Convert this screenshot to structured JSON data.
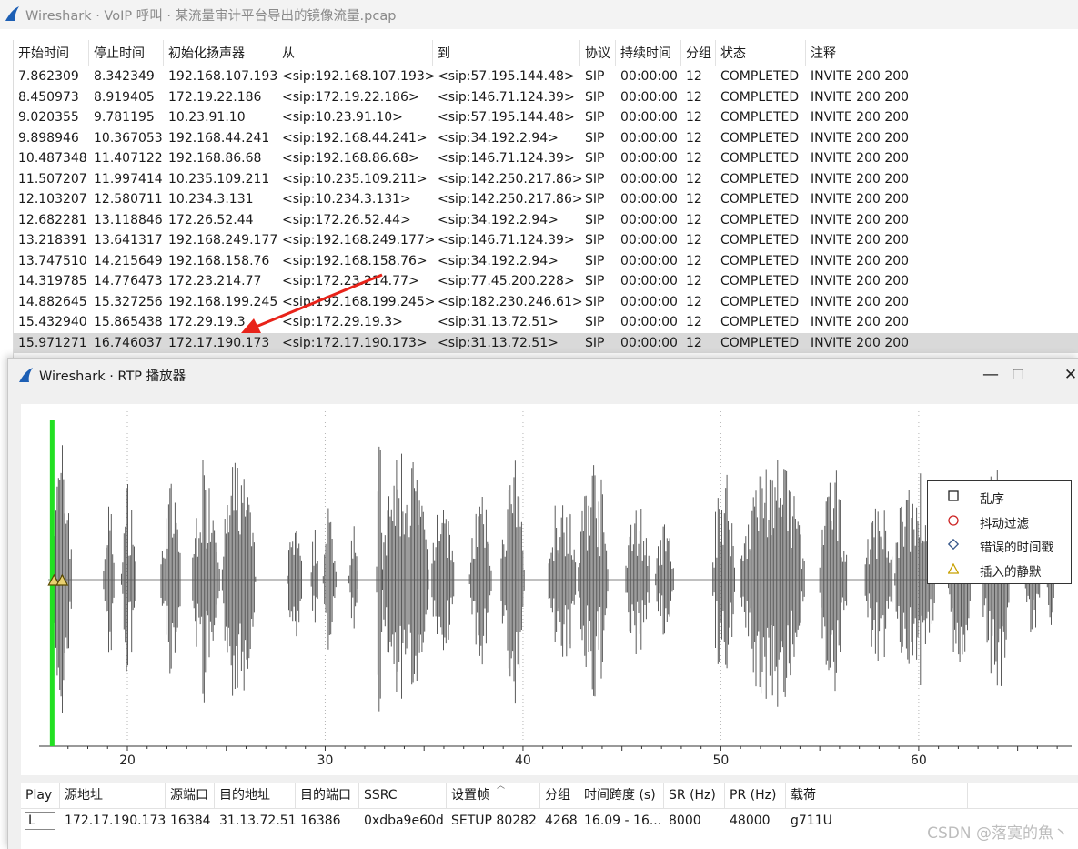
{
  "bg_window": {
    "title": "Wireshark · VoIP 呼叫 · 某流量审计平台导出的镜像流量.pcap",
    "columns": [
      "开始时间",
      "停止时间",
      "初始化扬声器",
      "从",
      "到",
      "协议",
      "持续时间",
      "分组",
      "状态",
      "注释"
    ],
    "rows": [
      [
        "7.862309",
        "8.342349",
        "192.168.107.193",
        "<sip:192.168.107.193>",
        "<sip:57.195.144.48>",
        "SIP",
        "00:00:00",
        "12",
        "COMPLETED",
        "INVITE 200 200"
      ],
      [
        "8.450973",
        "8.919405",
        "172.19.22.186",
        "<sip:172.19.22.186>",
        "<sip:146.71.124.39>",
        "SIP",
        "00:00:00",
        "12",
        "COMPLETED",
        "INVITE 200 200"
      ],
      [
        "9.020355",
        "9.781195",
        "10.23.91.10",
        "<sip:10.23.91.10>",
        "<sip:57.195.144.48>",
        "SIP",
        "00:00:00",
        "12",
        "COMPLETED",
        "INVITE 200 200"
      ],
      [
        "9.898946",
        "10.367053",
        "192.168.44.241",
        "<sip:192.168.44.241>",
        "<sip:34.192.2.94>",
        "SIP",
        "00:00:00",
        "12",
        "COMPLETED",
        "INVITE 200 200"
      ],
      [
        "10.487348",
        "11.407122",
        "192.168.86.68",
        "<sip:192.168.86.68>",
        "<sip:146.71.124.39>",
        "SIP",
        "00:00:00",
        "12",
        "COMPLETED",
        "INVITE 200 200"
      ],
      [
        "11.507207",
        "11.997414",
        "10.235.109.211",
        "<sip:10.235.109.211>",
        "<sip:142.250.217.86>",
        "SIP",
        "00:00:00",
        "12",
        "COMPLETED",
        "INVITE 200 200"
      ],
      [
        "12.103207",
        "12.580711",
        "10.234.3.131",
        "<sip:10.234.3.131>",
        "<sip:142.250.217.86>",
        "SIP",
        "00:00:00",
        "12",
        "COMPLETED",
        "INVITE 200 200"
      ],
      [
        "12.682281",
        "13.118846",
        "172.26.52.44",
        "<sip:172.26.52.44>",
        "<sip:34.192.2.94>",
        "SIP",
        "00:00:00",
        "12",
        "COMPLETED",
        "INVITE 200 200"
      ],
      [
        "13.218391",
        "13.641317",
        "192.168.249.177",
        "<sip:192.168.249.177>",
        "<sip:146.71.124.39>",
        "SIP",
        "00:00:00",
        "12",
        "COMPLETED",
        "INVITE 200 200"
      ],
      [
        "13.747510",
        "14.215649",
        "192.168.158.76",
        "<sip:192.168.158.76>",
        "<sip:34.192.2.94>",
        "SIP",
        "00:00:00",
        "12",
        "COMPLETED",
        "INVITE 200 200"
      ],
      [
        "14.319785",
        "14.776473",
        "172.23.214.77",
        "<sip:172.23.214.77>",
        "<sip:77.45.200.228>",
        "SIP",
        "00:00:00",
        "12",
        "COMPLETED",
        "INVITE 200 200"
      ],
      [
        "14.882645",
        "15.327256",
        "192.168.199.245",
        "<sip:192.168.199.245>",
        "<sip:182.230.246.61>",
        "SIP",
        "00:00:00",
        "12",
        "COMPLETED",
        "INVITE 200 200"
      ],
      [
        "15.432940",
        "15.865438",
        "172.29.19.3",
        "<sip:172.29.19.3>",
        "<sip:31.13.72.51>",
        "SIP",
        "00:00:00",
        "12",
        "COMPLETED",
        "INVITE 200 200"
      ],
      [
        "15.971271",
        "16.746037",
        "172.17.190.173",
        "<sip:172.17.190.173>",
        "<sip:31.13.72.51>",
        "SIP",
        "00:00:00",
        "12",
        "COMPLETED",
        "INVITE 200 200"
      ]
    ],
    "selected_row": 13
  },
  "rtp_window": {
    "title": "Wireshark · RTP 播放器",
    "minimize": "—",
    "maximize": "☐",
    "close": "✕",
    "legend": [
      {
        "label": "乱序",
        "symbol": "square",
        "color": "#222222"
      },
      {
        "label": "抖动过滤",
        "symbol": "circle",
        "color": "#cc2222"
      },
      {
        "label": "错误的时间戳",
        "symbol": "diamond",
        "color": "#3a5a8c"
      },
      {
        "label": "插入的静默",
        "symbol": "triangle",
        "color": "#c8a000"
      }
    ],
    "x_ticks": [
      "20",
      "30",
      "40",
      "50",
      "60"
    ],
    "streams_columns": [
      "Play",
      "源地址",
      "源端口",
      "目的地址",
      "目的端口",
      "SSRC",
      "设置帧",
      "分组",
      "时间跨度 (s)",
      "SR (Hz)",
      "PR (Hz)",
      "载荷"
    ],
    "stream": [
      "L",
      "172.17.190.173",
      "16384",
      "31.13.72.51",
      "16386",
      "0xdba9e60d",
      "SETUP 80282",
      "4268",
      "16.09 - 16...",
      "8000",
      "48000",
      "g711U"
    ]
  },
  "chart_data": {
    "type": "waveform",
    "x_ticks": [
      20,
      30,
      40,
      50,
      60
    ],
    "xlim": [
      16.0,
      67.5
    ],
    "playhead_x": 16.2,
    "bursts": [
      [
        16.2,
        17.3,
        0.95
      ],
      [
        18.8,
        19.4,
        0.55
      ],
      [
        19.7,
        20.5,
        0.68
      ],
      [
        21.7,
        22.8,
        0.65
      ],
      [
        23.3,
        24.8,
        0.85
      ],
      [
        24.8,
        26.6,
        0.88
      ],
      [
        28.1,
        28.9,
        0.42
      ],
      [
        29.3,
        29.7,
        0.35
      ],
      [
        29.9,
        30.6,
        0.5
      ],
      [
        31.2,
        31.7,
        0.52
      ],
      [
        32.6,
        32.9,
        1.0
      ],
      [
        32.9,
        35.4,
        0.95
      ],
      [
        35.4,
        36.6,
        0.62
      ],
      [
        37.3,
        38.5,
        0.6
      ],
      [
        38.9,
        40.2,
        0.82
      ],
      [
        41.3,
        42.8,
        0.7
      ],
      [
        42.8,
        44.4,
        0.86
      ],
      [
        45.2,
        46.5,
        0.55
      ],
      [
        46.7,
        47.7,
        0.38
      ],
      [
        49.6,
        50.8,
        0.8
      ],
      [
        51.0,
        54.5,
        0.92
      ],
      [
        55.0,
        56.5,
        0.75
      ],
      [
        57.3,
        58.8,
        0.6
      ],
      [
        58.8,
        61.0,
        0.78
      ],
      [
        61.5,
        62.7,
        0.68
      ],
      [
        63.2,
        64.7,
        0.85
      ],
      [
        65.4,
        66.2,
        0.4
      ],
      [
        66.5,
        66.9,
        0.3
      ]
    ]
  },
  "watermark": "CSDN @落寞的魚丶"
}
